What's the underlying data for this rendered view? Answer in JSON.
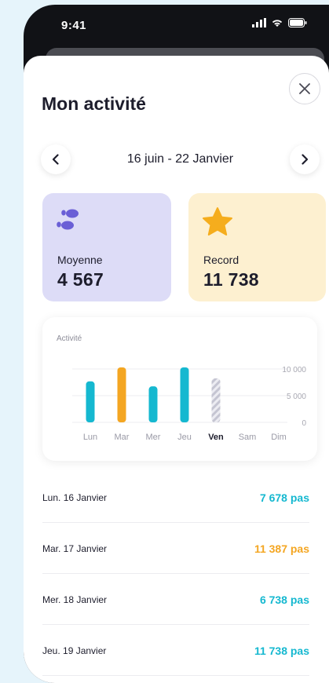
{
  "status": {
    "time": "9:41"
  },
  "header": {
    "title": "Mon activité"
  },
  "period": {
    "label": "16 juin - 22 Janvier"
  },
  "stats": {
    "average": {
      "label": "Moyenne",
      "value": "4 567"
    },
    "record": {
      "label": "Record",
      "value": "11 738"
    }
  },
  "colors": {
    "teal": "#15b8d0",
    "orange": "#f4a622",
    "avg_bg": "#dddcf7",
    "record_bg": "#fdf0d0",
    "icon_purple": "#6a5fd6",
    "star": "#f5ad1d"
  },
  "chart_data": {
    "type": "bar",
    "title": "Activité",
    "categories": [
      "Lun",
      "Mar",
      "Mer",
      "Jeu",
      "Ven",
      "Sam",
      "Dim"
    ],
    "highlighted_category": "Ven",
    "values": [
      7678,
      11387,
      6738,
      11738,
      null,
      null,
      null
    ],
    "in_progress": [
      false,
      false,
      false,
      false,
      true,
      false,
      false
    ],
    "bar_colors": [
      "#15b8d0",
      "#f4a622",
      "#15b8d0",
      "#15b8d0",
      "#c9c9d6",
      null,
      null
    ],
    "yticks": [
      "10 000",
      "5 000",
      "0"
    ],
    "ylim": [
      0,
      10000
    ],
    "grid": true
  },
  "entries": [
    {
      "date": "Lun. 16 Janvier",
      "steps": "7 678 pas",
      "color": "#15b8d0"
    },
    {
      "date": "Mar. 17 Janvier",
      "steps": "11 387 pas",
      "color": "#f4a622"
    },
    {
      "date": "Mer. 18 Janvier",
      "steps": "6 738 pas",
      "color": "#15b8d0"
    },
    {
      "date": "Jeu. 19 Janvier",
      "steps": "11 738 pas",
      "color": "#15b8d0"
    }
  ]
}
